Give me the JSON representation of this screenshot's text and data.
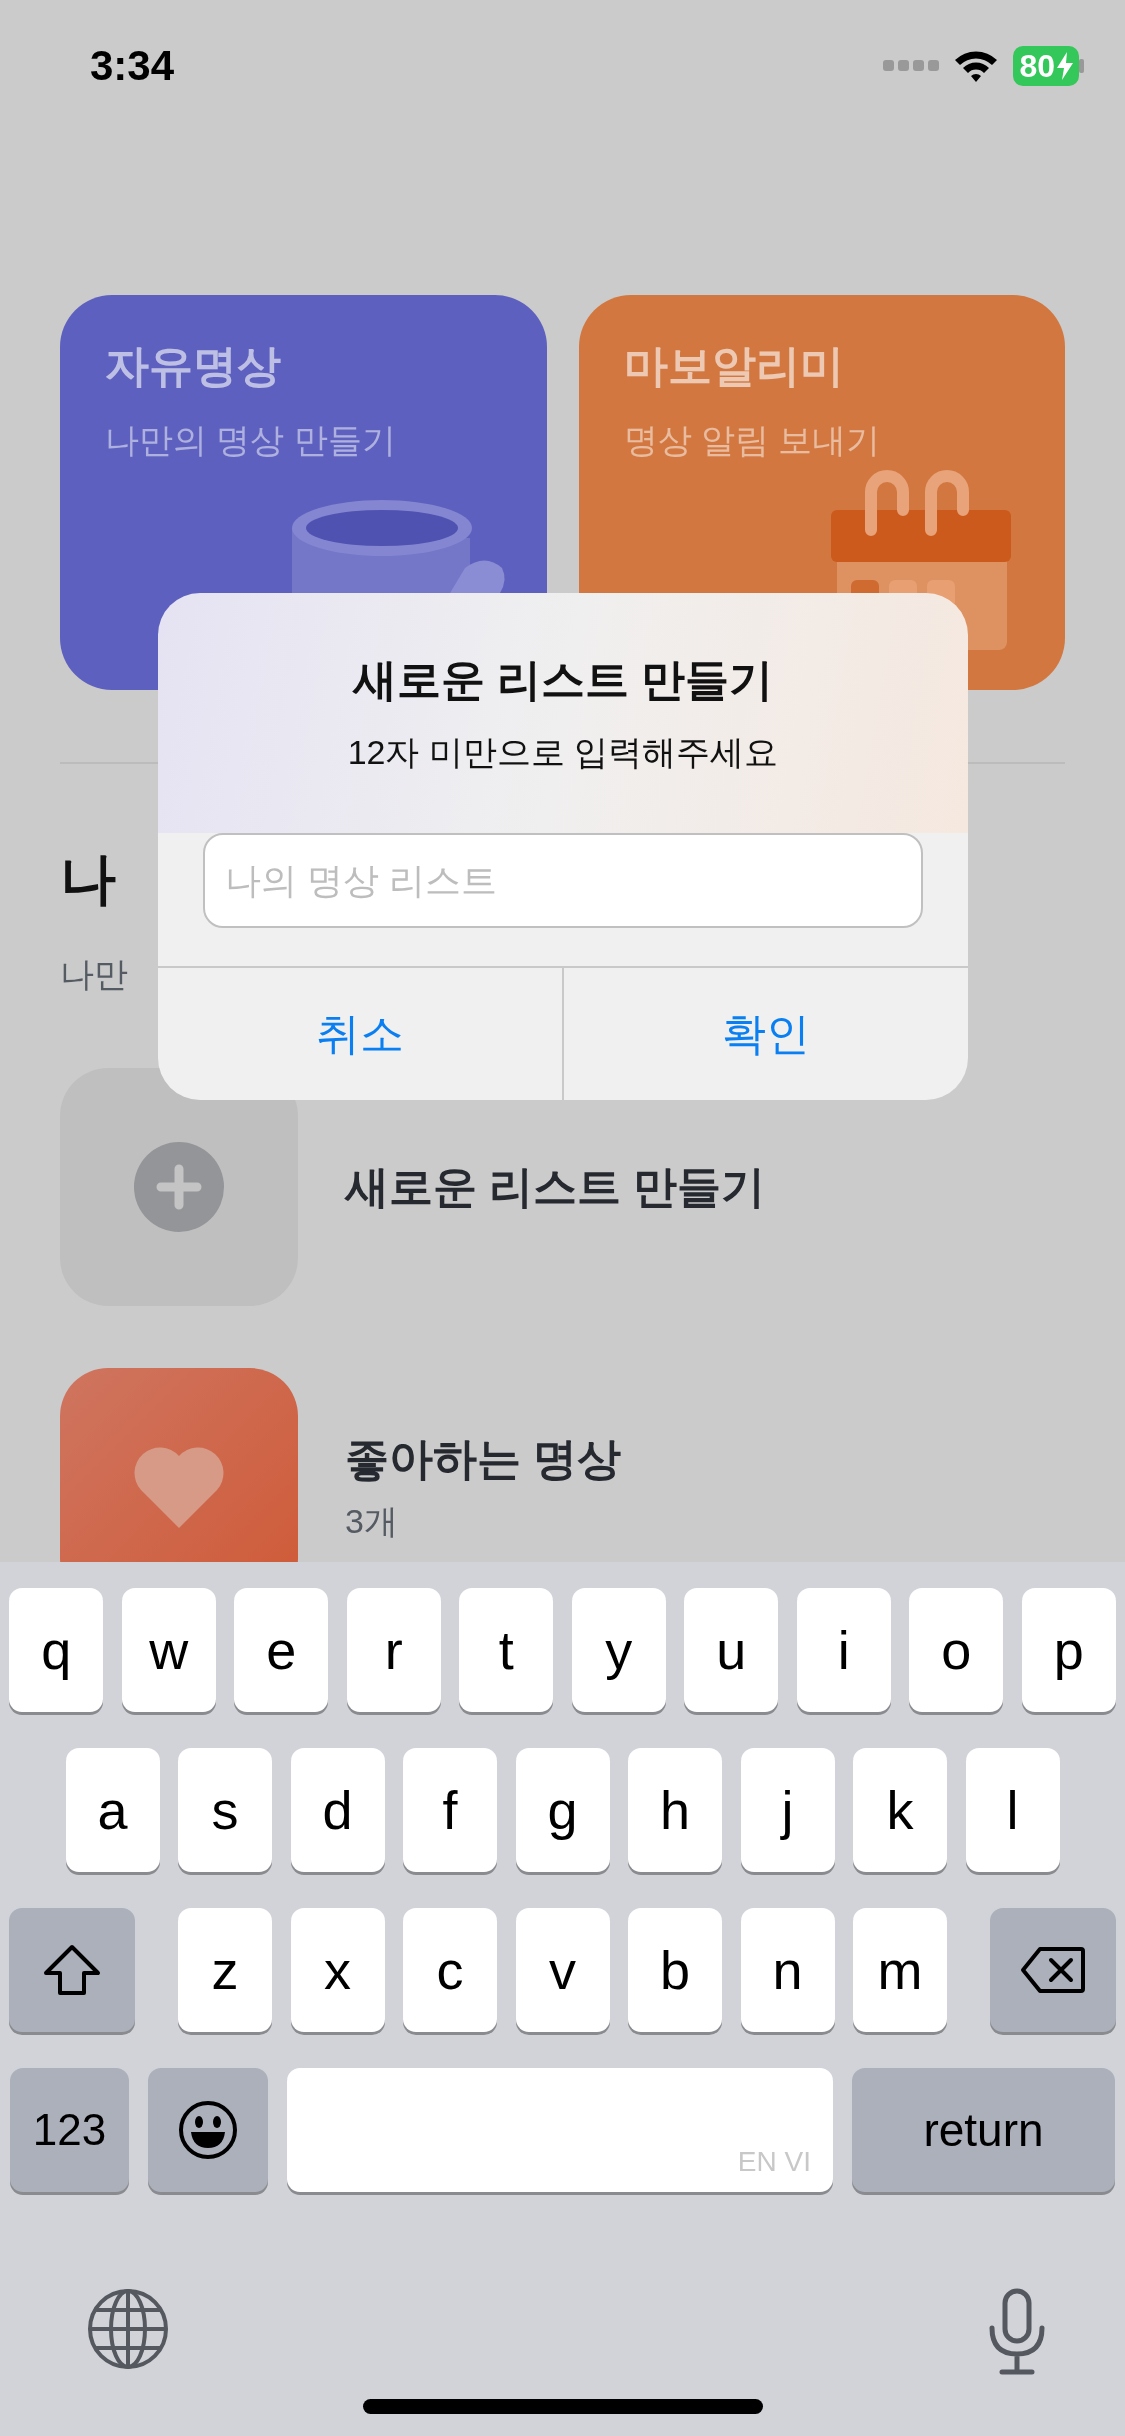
{
  "status_bar": {
    "time": "3:34",
    "battery": "80"
  },
  "cards": [
    {
      "kind": "bowl",
      "title": "자유명상",
      "subtitle": "나만의 명상 만들기",
      "color": "#5d60be"
    },
    {
      "kind": "calendar",
      "title": "마보알리미",
      "subtitle": "명상 알림 보내기",
      "color": "#d2773f"
    }
  ],
  "section": {
    "title": "나",
    "subtitle": "나만"
  },
  "lists": [
    {
      "kind": "add",
      "title": "새로운 리스트 만들기"
    },
    {
      "kind": "favorite",
      "title": "좋아하는 명상",
      "count": "3개"
    }
  ],
  "dialog": {
    "title": "새로운 리스트 만들기",
    "message": "12자 미만으로 입력해주세요",
    "field": {
      "placeholder": "나의 명상 리스트"
    },
    "buttons": [
      {
        "label": "취소"
      },
      {
        "label": "확인"
      }
    ]
  },
  "keyboard": {
    "rows": [
      [
        "q",
        "w",
        "e",
        "r",
        "t",
        "y",
        "u",
        "i",
        "o",
        "p"
      ],
      [
        "a",
        "s",
        "d",
        "f",
        "g",
        "h",
        "j",
        "k",
        "l"
      ],
      [
        "z",
        "x",
        "c",
        "v",
        "b",
        "n",
        "m"
      ]
    ],
    "numbers_key": "123",
    "space_hint": "EN VI",
    "return_key": "return"
  }
}
